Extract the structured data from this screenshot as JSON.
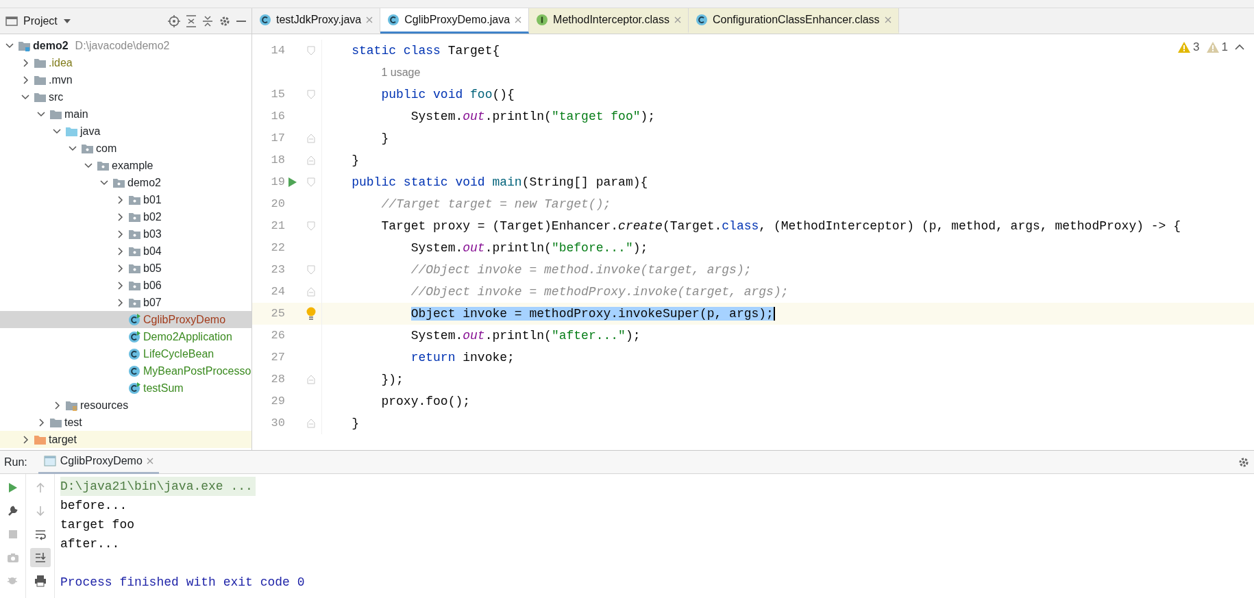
{
  "project_panel": {
    "title": "Project",
    "tree": [
      {
        "label": "demo2",
        "path": "D:\\javacode\\demo2",
        "kind": "module",
        "expanded": true,
        "selected": false,
        "children": [
          {
            "label": ".idea",
            "kind": "folder",
            "expanded": false,
            "selected": false,
            "color": "#7f7a18"
          },
          {
            "label": ".mvn",
            "kind": "folder",
            "expanded": false,
            "selected": false
          },
          {
            "label": "src",
            "kind": "folder",
            "expanded": true,
            "selected": false,
            "children": [
              {
                "label": "main",
                "kind": "folder",
                "expanded": true,
                "selected": false,
                "children": [
                  {
                    "label": "java",
                    "kind": "source-root",
                    "expanded": true,
                    "selected": false,
                    "children": [
                      {
                        "label": "com",
                        "kind": "package",
                        "expanded": true,
                        "selected": false,
                        "children": [
                          {
                            "label": "example",
                            "kind": "package",
                            "expanded": true,
                            "selected": false,
                            "children": [
                              {
                                "label": "demo2",
                                "kind": "package",
                                "expanded": true,
                                "selected": false,
                                "children": [
                                  {
                                    "label": "b01",
                                    "kind": "package",
                                    "expanded": false,
                                    "selected": false
                                  },
                                  {
                                    "label": "b02",
                                    "kind": "package",
                                    "expanded": false,
                                    "selected": false
                                  },
                                  {
                                    "label": "b03",
                                    "kind": "package",
                                    "expanded": false,
                                    "selected": false
                                  },
                                  {
                                    "label": "b04",
                                    "kind": "package",
                                    "expanded": false,
                                    "selected": false
                                  },
                                  {
                                    "label": "b05",
                                    "kind": "package",
                                    "expanded": false,
                                    "selected": false
                                  },
                                  {
                                    "label": "b06",
                                    "kind": "package",
                                    "expanded": false,
                                    "selected": false
                                  },
                                  {
                                    "label": "b07",
                                    "kind": "package",
                                    "expanded": false,
                                    "selected": false
                                  },
                                  {
                                    "label": "CglibProxyDemo",
                                    "kind": "runnable-class",
                                    "selected": true,
                                    "color": "#a23c1c"
                                  },
                                  {
                                    "label": "Demo2Application",
                                    "kind": "runnable-class",
                                    "selected": false,
                                    "color": "#3a8a1f"
                                  },
                                  {
                                    "label": "LifeCycleBean",
                                    "kind": "class",
                                    "selected": false,
                                    "color": "#3a8a1f"
                                  },
                                  {
                                    "label": "MyBeanPostProcesso",
                                    "kind": "class",
                                    "selected": false,
                                    "color": "#3a8a1f"
                                  },
                                  {
                                    "label": "testSum",
                                    "kind": "runnable-class",
                                    "selected": false,
                                    "color": "#3a8a1f"
                                  }
                                ]
                              }
                            ]
                          }
                        ]
                      }
                    ]
                  },
                  {
                    "label": "resources",
                    "kind": "resources",
                    "expanded": false,
                    "selected": false
                  }
                ]
              },
              {
                "label": "test",
                "kind": "folder",
                "expanded": false,
                "selected": false
              }
            ]
          },
          {
            "label": "target",
            "kind": "excluded",
            "expanded": false,
            "selected": false
          }
        ]
      }
    ]
  },
  "tabs": [
    {
      "label": "testJdkProxy.java",
      "kind": "class-source",
      "selected": false
    },
    {
      "label": "CglibProxyDemo.java",
      "kind": "class-source",
      "selected": true
    },
    {
      "label": "MethodInterceptor.class",
      "kind": "interface-library",
      "selected": false
    },
    {
      "label": "ConfigurationClassEnhancer.class",
      "kind": "class-library",
      "selected": false
    }
  ],
  "inspections": [
    {
      "kind": "warning",
      "count": "3"
    },
    {
      "kind": "weak-warning",
      "count": "1"
    }
  ],
  "editor": {
    "lines": [
      {
        "kind": "code",
        "number": "14",
        "fold_start": true,
        "tokens": [
          {
            "text": "    static class ",
            "kind": "keyword"
          },
          {
            "text": "Target{",
            "kind": "plain"
          }
        ]
      },
      {
        "kind": "inlay",
        "text": "1 usage"
      },
      {
        "kind": "code",
        "number": "15",
        "fold_start": true,
        "tokens": [
          {
            "text": "        public void ",
            "kind": "keyword"
          },
          {
            "text": "foo",
            "kind": "method"
          },
          {
            "text": "(){",
            "kind": "plain"
          }
        ]
      },
      {
        "kind": "code",
        "number": "16",
        "tokens": [
          {
            "text": "            System.",
            "kind": "plain"
          },
          {
            "text": "out",
            "kind": "field"
          },
          {
            "text": ".println(",
            "kind": "plain"
          },
          {
            "text": "\"target foo\"",
            "kind": "string"
          },
          {
            "text": ");",
            "kind": "plain"
          }
        ]
      },
      {
        "kind": "code",
        "number": "17",
        "fold_end": true,
        "tokens": [
          {
            "text": "        }",
            "kind": "plain"
          }
        ]
      },
      {
        "kind": "code",
        "number": "18",
        "fold_end": true,
        "tokens": [
          {
            "text": "    }",
            "kind": "plain"
          }
        ]
      },
      {
        "kind": "code",
        "number": "19",
        "fold_start": true,
        "run": true,
        "tokens": [
          {
            "text": "    public static void ",
            "kind": "keyword"
          },
          {
            "text": "main",
            "kind": "method"
          },
          {
            "text": "(String[] param){",
            "kind": "plain"
          }
        ]
      },
      {
        "kind": "code",
        "number": "20",
        "tokens": [
          {
            "text": "        //Target target = new Target();",
            "kind": "comment"
          }
        ]
      },
      {
        "kind": "code",
        "number": "21",
        "fold_start": true,
        "tokens": [
          {
            "text": "        Target proxy = (Target)Enhancer.",
            "kind": "plain"
          },
          {
            "text": "create",
            "kind": "static-call"
          },
          {
            "text": "(Target.",
            "kind": "plain"
          },
          {
            "text": "class",
            "kind": "keyword"
          },
          {
            "text": ", (MethodInterceptor) (p, method, args, methodProxy) -> {",
            "kind": "plain"
          }
        ]
      },
      {
        "kind": "code",
        "number": "22",
        "tokens": [
          {
            "text": "            System.",
            "kind": "plain"
          },
          {
            "text": "out",
            "kind": "field"
          },
          {
            "text": ".println(",
            "kind": "plain"
          },
          {
            "text": "\"before...\"",
            "kind": "string"
          },
          {
            "text": ");",
            "kind": "plain"
          }
        ]
      },
      {
        "kind": "code",
        "number": "23",
        "fold_start": true,
        "tokens": [
          {
            "text": "            //Object invoke = method.invoke(target, args);",
            "kind": "comment"
          }
        ]
      },
      {
        "kind": "code",
        "number": "24",
        "fold_end": true,
        "tokens": [
          {
            "text": "            //Object invoke = methodProxy.invoke(target, args);",
            "kind": "comment"
          }
        ]
      },
      {
        "kind": "code",
        "number": "25",
        "current": true,
        "selected": true,
        "bulb": true,
        "tokens": [
          {
            "text": "            Object invoke = methodProxy.invokeSuper(p, args);",
            "kind": "plain"
          }
        ]
      },
      {
        "kind": "code",
        "number": "26",
        "tokens": [
          {
            "text": "            System.",
            "kind": "plain"
          },
          {
            "text": "out",
            "kind": "field"
          },
          {
            "text": ".println(",
            "kind": "plain"
          },
          {
            "text": "\"after...\"",
            "kind": "string"
          },
          {
            "text": ");",
            "kind": "plain"
          }
        ]
      },
      {
        "kind": "code",
        "number": "27",
        "tokens": [
          {
            "text": "            return ",
            "kind": "keyword"
          },
          {
            "text": "invoke;",
            "kind": "plain"
          }
        ]
      },
      {
        "kind": "code",
        "number": "28",
        "fold_end": true,
        "tokens": [
          {
            "text": "        });",
            "kind": "plain"
          }
        ]
      },
      {
        "kind": "code",
        "number": "29",
        "tokens": [
          {
            "text": "        proxy.foo();",
            "kind": "plain"
          }
        ]
      },
      {
        "kind": "code",
        "number": "30",
        "fold_end": true,
        "tokens": [
          {
            "text": "    }",
            "kind": "plain"
          }
        ]
      }
    ]
  },
  "run_panel": {
    "label": "Run:",
    "tab": "CglibProxyDemo",
    "output": [
      {
        "text": "D:\\java21\\bin\\java.exe ...",
        "kind": "command"
      },
      {
        "text": "before...",
        "kind": "stdout"
      },
      {
        "text": "target foo",
        "kind": "stdout"
      },
      {
        "text": "after...",
        "kind": "stdout"
      },
      {
        "kind": "blank"
      },
      {
        "text": "Process finished with exit code 0",
        "kind": "exit"
      }
    ]
  }
}
